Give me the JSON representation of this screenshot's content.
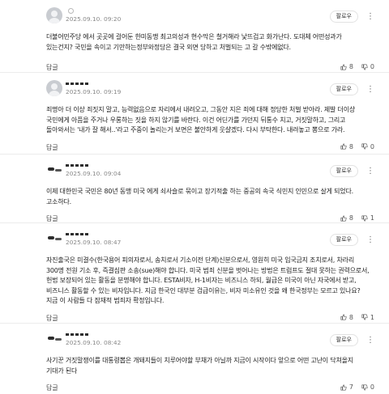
{
  "comments": [
    {
      "nickname": "",
      "date": "2025.09.10. 09:20",
      "report_label": "팔로우",
      "text": "더불어민주당 에서 곳곳에 걸어둔 한미동맹 최고의성과 현수막은 철거해라 낯뜨겁고 화가난다. 도대체 어떤성과가 있는건지? 국민을 속이고 기만하는정부와정당은 결국 외면 당하고 처벌되는 고 갈 수밖에없다.",
      "reply_label": "답글",
      "likes": "8",
      "dislikes": "0"
    },
    {
      "nickname": "",
      "date": "2025.09.10. 09:19",
      "report_label": "팔로우",
      "text": "죄명아 더 이상 죄짓지 말고, 능력없음으로 자리에서 내려오고, 그동안 지은 죄에 대해 정당한 처벌 받아라. 제발 더이상 국민에게 아픔을 주거나 우롱하는 짓을 하지 않기를 바란다. 이건 어딘가를 가던지 뒤통수 치고, 거짓말하고, 그리고 돌아와서는 '내가 잘 해서..'라고 주중이 놀리는거 보면은 불안하게 웃샬겠다. 다시 부탁한다. 내려놓고 뽕으로 가라.",
      "reply_label": "답글",
      "likes": "8",
      "dislikes": "0"
    },
    {
      "nickname": "",
      "date": "2025.09.10. 09:04",
      "report_label": "팔로우",
      "text": "이제 대한민국 국민은 80년 동맹 미국 에게 쇠사슬로 묶이고 장기적출 하는 중공의 속국 식민지 인민으로 살게 되었다. 고소하다.",
      "reply_label": "답글",
      "likes": "8",
      "dislikes": "1"
    },
    {
      "nickname": "",
      "date": "2025.09.10. 08:47",
      "report_label": "팔로우",
      "text": "자진출국은 미결수(한국용어 피의자로서, 송치로서 기소이전 단계)신분으로서, 영원히 미국 입국금지 조치로서, 차라리 300명 전원 기소 후, 즉결심판 소송(sue)해야 합니다. 미국 범죄 신분을 벗어나는 방법은 트럼프도 절대 못하는 권력으로서, 헌법 보장되어 있는 활동을 분명해야 합니다. ESTA비자, H-1비자는 비즈니스 하되, 월급은 미국이 아닌 자국에서 받고, 비즈니스 활동할 수 있는 비자입니다. 지금 한국인 대부분 검급이유는, 비자 미소유인 것을 왜 한국정부는 모르고 있나요? 지금 이 사람들 다 잠재적 범죄자 확정입니다.",
      "reply_label": "답글",
      "likes": "8",
      "dislikes": "1"
    },
    {
      "nickname": "",
      "date": "2025.09.10. 08:42",
      "report_label": "팔로우",
      "text": "사기꾼 거짓말쟁이를 대통령뽑은 개돼지들이 치루어야할 부채가 아닐까 지금이 시작이다 앞으로 어떤 고난이 닥쳐올지 기대가 된다",
      "reply_label": "답글",
      "likes": "7",
      "dislikes": "0"
    }
  ]
}
